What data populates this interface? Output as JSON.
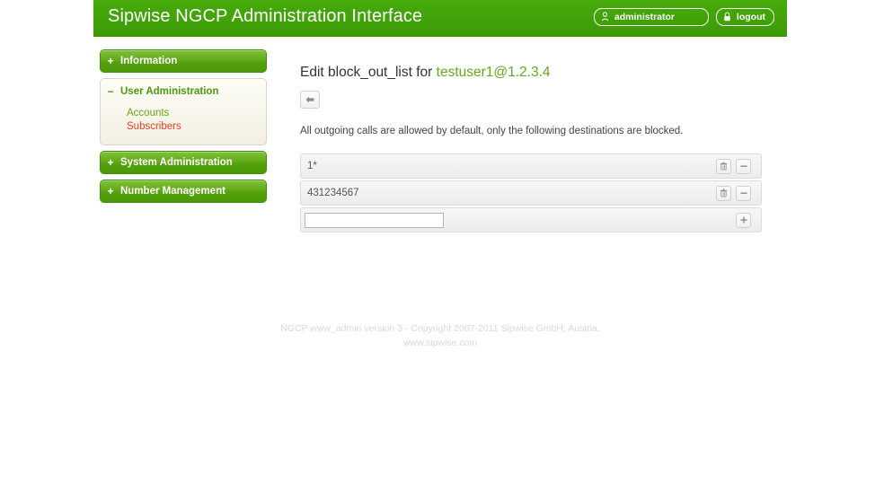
{
  "header": {
    "title": "Sipwise NGCP Administration Interface",
    "user_button": {
      "label": "administrator",
      "icon": "user-icon"
    },
    "logout_button": {
      "label": "logout",
      "icon": "lock-icon"
    },
    "background_color": "#3fa007"
  },
  "sidebar": {
    "items": [
      {
        "label": "Information",
        "sign": "+",
        "expanded": false,
        "children": []
      },
      {
        "label": "User Administration",
        "sign": "−",
        "expanded": true,
        "children": [
          {
            "label": "Accounts",
            "active": false
          },
          {
            "label": "Subscribers",
            "active": true
          }
        ]
      },
      {
        "label": "System Administration",
        "sign": "+",
        "expanded": false,
        "children": []
      },
      {
        "label": "Number Management",
        "sign": "+",
        "expanded": false,
        "children": []
      }
    ],
    "active_color": "#e8402a",
    "link_color": "#63ab18"
  },
  "main": {
    "title_prefix": "Edit block_out_list for",
    "title_user": "testuser1@1.2.3.4",
    "back_button": {
      "icon": "arrow-left-icon",
      "label": ""
    },
    "hint": "All outgoing calls are allowed by default, only the following destinations are blocked.",
    "rows": [
      {
        "value": "1*",
        "actions": [
          {
            "icon": "trash-icon",
            "label": ""
          },
          {
            "icon": "minus-icon",
            "label": ""
          }
        ]
      },
      {
        "value": "431234567",
        "actions": [
          {
            "icon": "trash-icon",
            "label": ""
          },
          {
            "icon": "minus-icon",
            "label": ""
          }
        ]
      }
    ],
    "new_row": {
      "value": "",
      "placeholder": "",
      "add_button": {
        "icon": "plus-icon",
        "label": ""
      }
    }
  },
  "footer": {
    "line1": "NGCP www_admin version 3 - Copyright 2007-2011 Sipwise GmbH, Austria.",
    "line2": "www.sipwise.com"
  }
}
